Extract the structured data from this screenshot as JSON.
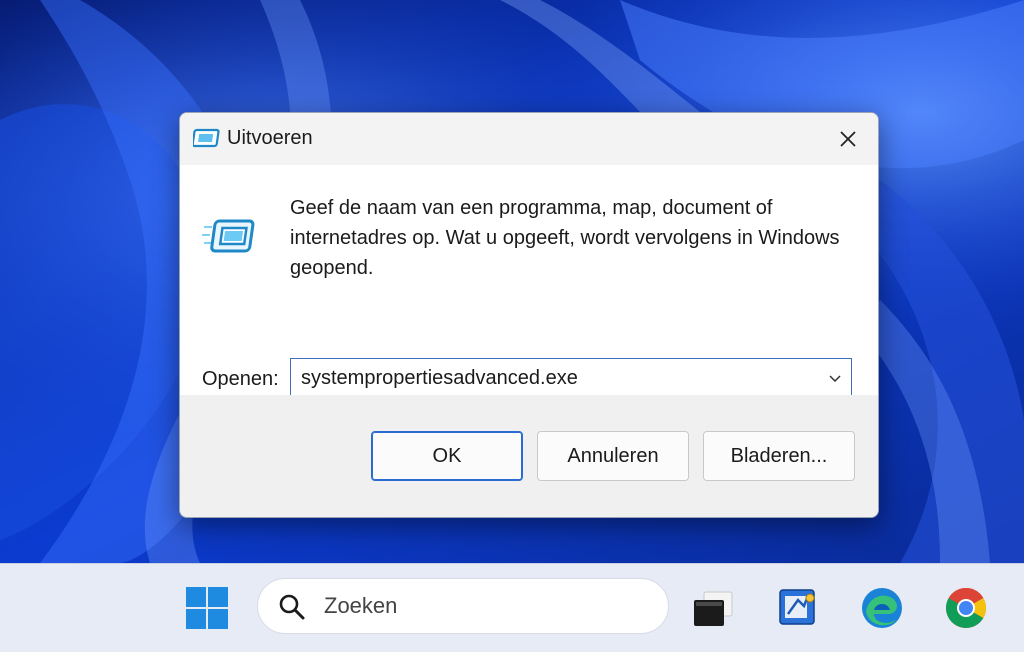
{
  "dialog": {
    "title": "Uitvoeren",
    "description": "Geef de naam van een programma, map, document of internetadres op. Wat u opgeeft, wordt vervolgens in Windows geopend.",
    "open_label": "Openen:",
    "open_value": "systempropertiesadvanced.exe",
    "buttons": {
      "ok": "OK",
      "cancel": "Annuleren",
      "browse": "Bladeren..."
    },
    "icons": {
      "title": "run-icon",
      "close": "close-icon",
      "dropdown": "chevron-down-icon"
    }
  },
  "taskbar": {
    "search_placeholder": "Zoeken",
    "icons": [
      "windows-start-icon",
      "search-icon",
      "task-view-icon",
      "system-app-icon",
      "edge-icon",
      "chrome-icon"
    ]
  },
  "colors": {
    "accent": "#2a6bd1",
    "wallpaper_dark": "#0a1e78",
    "wallpaper_light": "#2f6bff",
    "taskbar": "#e6ebf5"
  }
}
